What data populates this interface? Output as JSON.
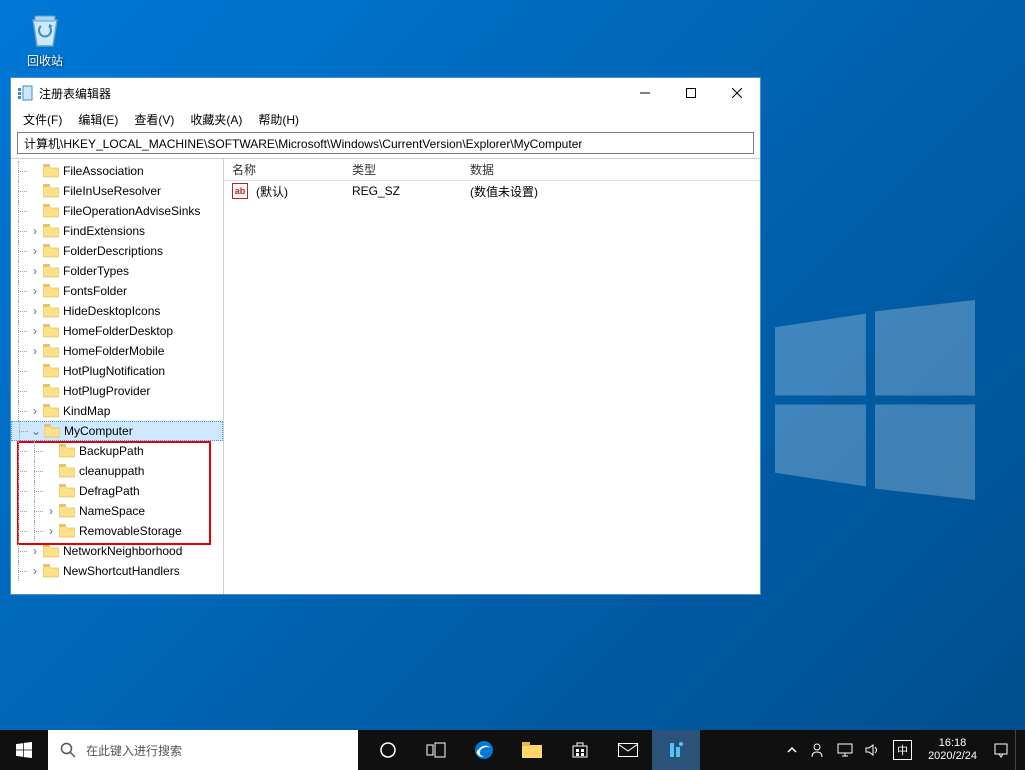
{
  "desktop": {
    "recycle_bin": "回收站"
  },
  "window": {
    "title": "注册表编辑器",
    "menu": [
      "文件(F)",
      "编辑(E)",
      "查看(V)",
      "收藏夹(A)",
      "帮助(H)"
    ],
    "address": "计算机\\HKEY_LOCAL_MACHINE\\SOFTWARE\\Microsoft\\Windows\\CurrentVersion\\Explorer\\MyComputer"
  },
  "tree": [
    {
      "indent": 1,
      "exp": "",
      "label": "FileAssociation"
    },
    {
      "indent": 1,
      "exp": "",
      "label": "FileInUseResolver"
    },
    {
      "indent": 1,
      "exp": "",
      "label": "FileOperationAdviseSinks"
    },
    {
      "indent": 1,
      "exp": ">",
      "label": "FindExtensions"
    },
    {
      "indent": 1,
      "exp": ">",
      "label": "FolderDescriptions"
    },
    {
      "indent": 1,
      "exp": ">",
      "label": "FolderTypes"
    },
    {
      "indent": 1,
      "exp": ">",
      "label": "FontsFolder"
    },
    {
      "indent": 1,
      "exp": ">",
      "label": "HideDesktopIcons"
    },
    {
      "indent": 1,
      "exp": ">",
      "label": "HomeFolderDesktop"
    },
    {
      "indent": 1,
      "exp": ">",
      "label": "HomeFolderMobile"
    },
    {
      "indent": 1,
      "exp": "",
      "label": "HotPlugNotification"
    },
    {
      "indent": 1,
      "exp": "",
      "label": "HotPlugProvider"
    },
    {
      "indent": 1,
      "exp": ">",
      "label": "KindMap"
    },
    {
      "indent": 1,
      "exp": "v",
      "label": "MyComputer",
      "selected": true
    },
    {
      "indent": 2,
      "exp": "",
      "label": "BackupPath"
    },
    {
      "indent": 2,
      "exp": "",
      "label": "cleanuppath"
    },
    {
      "indent": 2,
      "exp": "",
      "label": "DefragPath"
    },
    {
      "indent": 2,
      "exp": ">",
      "label": "NameSpace"
    },
    {
      "indent": 2,
      "exp": ">",
      "label": "RemovableStorage"
    },
    {
      "indent": 1,
      "exp": ">",
      "label": "NetworkNeighborhood"
    },
    {
      "indent": 1,
      "exp": ">",
      "label": "NewShortcutHandlers"
    }
  ],
  "list": {
    "headers": {
      "name": "名称",
      "type": "类型",
      "data": "数据"
    },
    "rows": [
      {
        "icon": "ab",
        "name": "(默认)",
        "type": "REG_SZ",
        "data": "(数值未设置)"
      }
    ]
  },
  "taskbar": {
    "search_placeholder": "在此键入进行搜索",
    "ime": "中",
    "time": "16:18",
    "date": "2020/2/24"
  }
}
